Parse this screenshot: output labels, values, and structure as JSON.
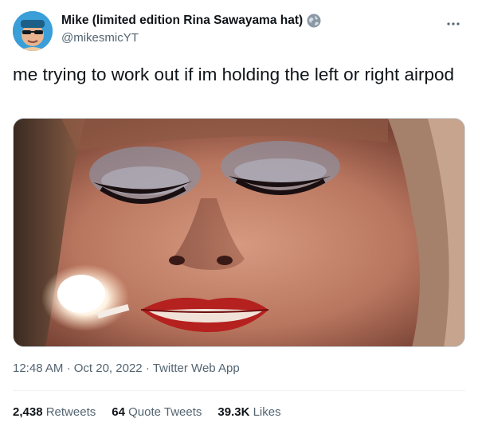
{
  "author": {
    "display_name": "Mike (limited edition Rina Sawayama hat)",
    "handle": "@mikesmicYT",
    "avatar_icon": "avatar-photo",
    "badge_icon": "globe-icon"
  },
  "tweet": {
    "text": "me trying to work out if im holding the left or right airpod",
    "media_icon": "photo-close-up-face-with-lit-match"
  },
  "meta": {
    "time": "12:48 AM",
    "separator1": "·",
    "date": "Oct 20, 2022",
    "separator2": "·",
    "source": "Twitter Web App"
  },
  "stats": {
    "retweets_count": "2,438",
    "retweets_label": "Retweets",
    "quotes_count": "64",
    "quotes_label": "Quote Tweets",
    "likes_count": "39.3K",
    "likes_label": "Likes"
  },
  "more_icon": "more-horizontal-icon",
  "colors": {
    "text_primary": "#0f1419",
    "text_secondary": "#536471",
    "divider": "#eff3f4",
    "avatar_bg": "#3a9ed8"
  }
}
